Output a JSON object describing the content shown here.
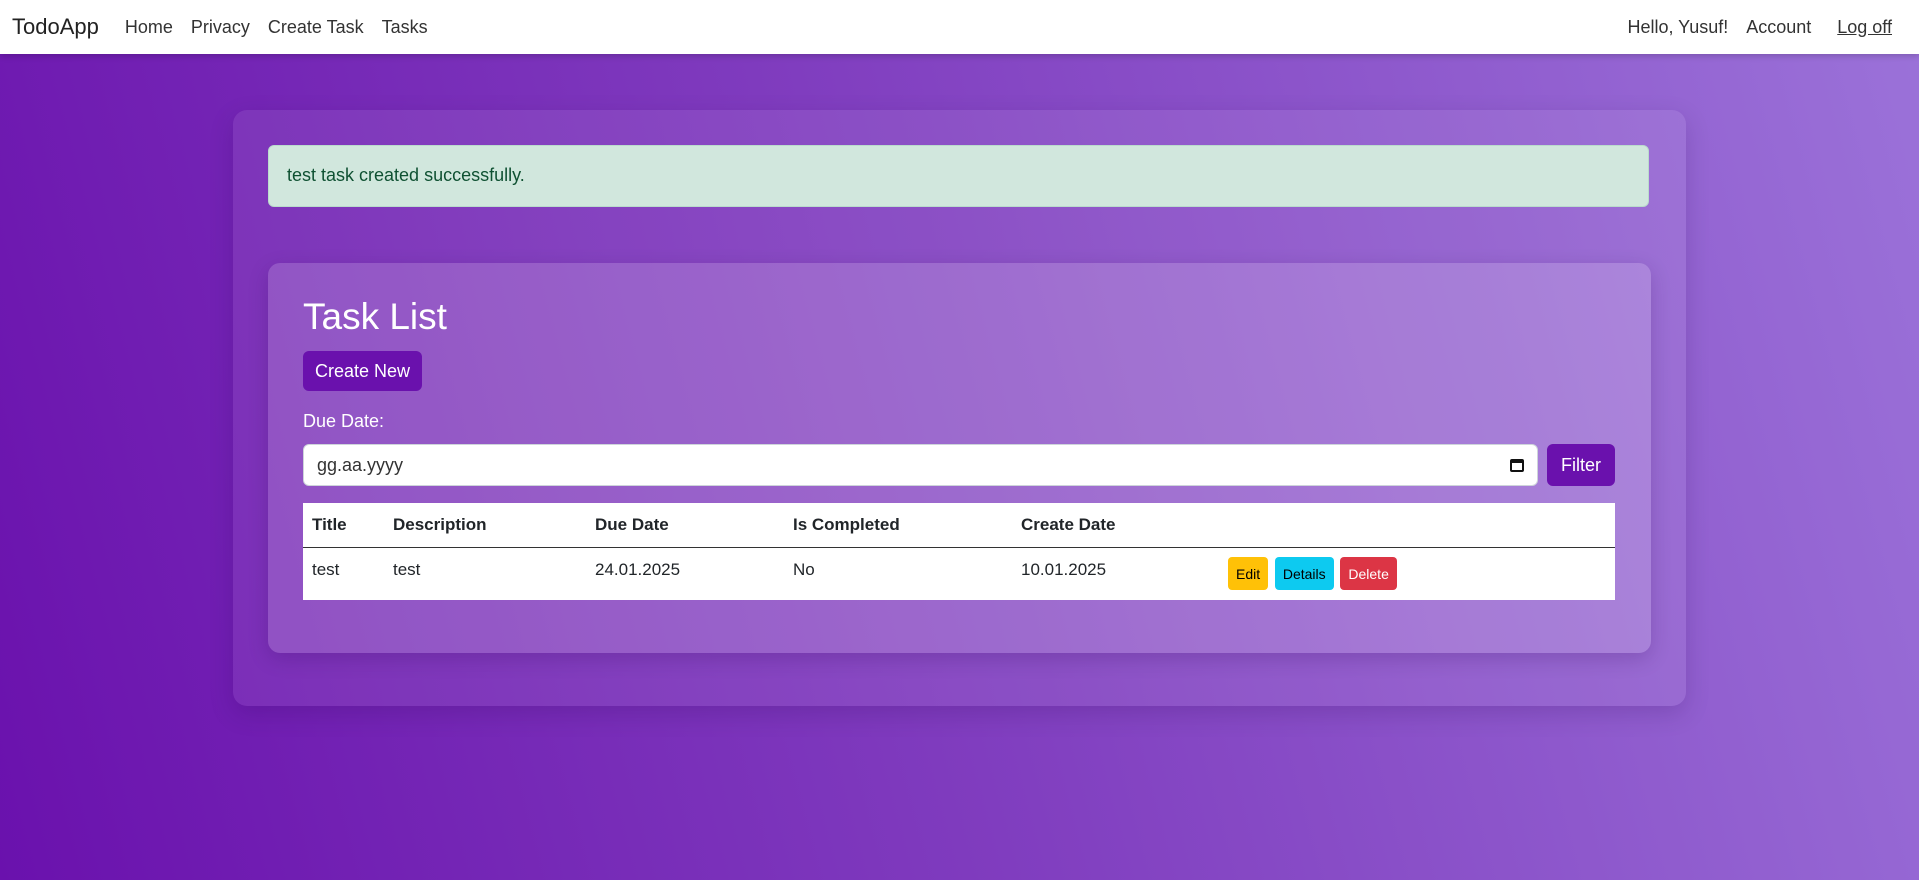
{
  "navbar": {
    "brand": "TodoApp",
    "links": [
      "Home",
      "Privacy",
      "Create Task",
      "Tasks"
    ],
    "greeting": "Hello, Yusuf!",
    "account": "Account",
    "logoff": "Log off"
  },
  "alert": {
    "message": "test task created successfully."
  },
  "main": {
    "title": "Task List",
    "create_button": "Create New",
    "due_date_label": "Due Date:",
    "due_date_value": "gg.aa.yyyy",
    "filter_button": "Filter",
    "table": {
      "headers": [
        "Title",
        "Description",
        "Due Date",
        "Is Completed",
        "Create Date",
        ""
      ],
      "rows": [
        {
          "title": "test",
          "description": "test",
          "due_date": "24.01.2025",
          "is_completed": "No",
          "create_date": "10.01.2025",
          "actions": [
            "Edit",
            "Details",
            "Delete"
          ]
        }
      ]
    }
  },
  "colors": {
    "primary": "#6a11ad",
    "alert_bg": "#d1e7dd",
    "alert_text": "#0f5132",
    "edit": "#ffc107",
    "details": "#0dcaf0",
    "delete": "#dc3545"
  },
  "icons": {
    "date_picker": "calendar-icon"
  }
}
